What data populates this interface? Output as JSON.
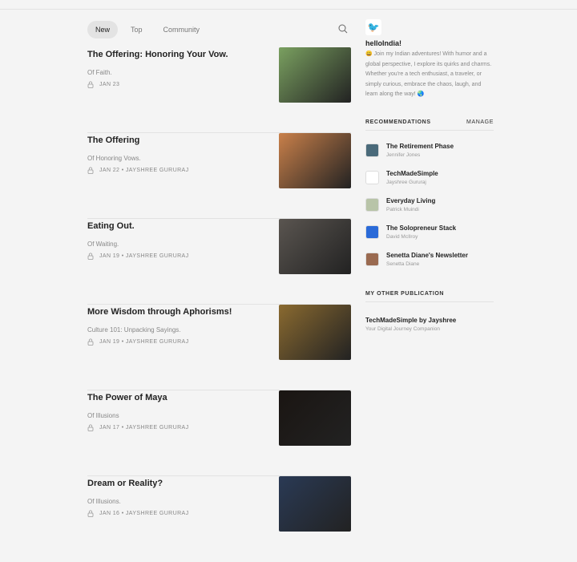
{
  "tabs": [
    "New",
    "Top",
    "Community"
  ],
  "posts": [
    {
      "title": "The Offering: Honoring Your Vow.",
      "subtitle": "Of Faith.",
      "meta": "JAN 23",
      "thumb": "#7aa060"
    },
    {
      "title": "The Offering",
      "subtitle": "Of Honoring Vows.",
      "meta": "JAN 22 • JAYSHREE GURURAJ",
      "thumb": "#c9804a"
    },
    {
      "title": "Eating Out.",
      "subtitle": "Of Waiting.",
      "meta": "JAN 19 • JAYSHREE GURURAJ",
      "thumb": "#5a5550"
    },
    {
      "title": "More Wisdom through Aphorisms!",
      "subtitle": "Culture 101: Unpacking Sayings.",
      "meta": "JAN 19 • JAYSHREE GURURAJ",
      "thumb": "#8a6a30"
    },
    {
      "title": "The Power of Maya",
      "subtitle": "Of Illusions",
      "meta": "JAN 17 • JAYSHREE GURURAJ",
      "thumb": "#1a1512"
    },
    {
      "title": "Dream or Reality?",
      "subtitle": "Of Illusions.",
      "meta": "JAN 16 • JAYSHREE GURURAJ",
      "thumb": "#2a3a55"
    }
  ],
  "sidebar": {
    "name": "helloIndia!",
    "description": "😀 Join my Indian adventures! With humor and a global perspective, I explore its quirks and charms. Whether you're a tech enthusiast, a traveler, or simply curious, embrace the chaos, laugh, and learn along the way! 🌏",
    "recommendations_label": "RECOMMENDATIONS",
    "manage_label": "MANAGE",
    "recommendations": [
      {
        "title": "The Retirement Phase",
        "author": "Jennifer Jones",
        "color": "#4a6a7a"
      },
      {
        "title": "TechMadeSimple",
        "author": "Jayshree Gururaj",
        "color": "#ffffff"
      },
      {
        "title": "Everyday Living",
        "author": "Patrick Muindi",
        "color": "#b8c4a8"
      },
      {
        "title": "The Solopreneur Stack",
        "author": "David McIlroy",
        "color": "#2a6ad8"
      },
      {
        "title": "Senetta Diane's Newsletter",
        "author": "Senetta Diane",
        "color": "#9a6a50"
      }
    ],
    "other_label": "MY OTHER PUBLICATION",
    "other": {
      "title": "TechMadeSimple by Jayshree",
      "subtitle": "Your Digital Journey Companion"
    }
  }
}
